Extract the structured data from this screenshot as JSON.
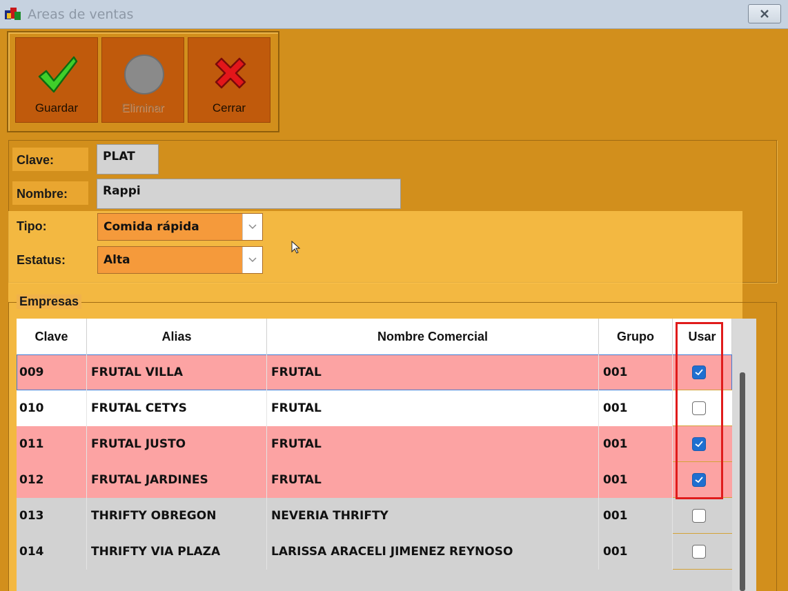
{
  "window": {
    "title": "Areas de ventas",
    "icon": "app-icon",
    "close_icon": "close-icon"
  },
  "toolbar": {
    "buttons": [
      {
        "label": "Guardar",
        "icon": "check-icon",
        "enabled": true
      },
      {
        "label": "Eliminar",
        "icon": "gray-circle-icon",
        "enabled": false
      },
      {
        "label": "Cerrar",
        "icon": "red-x-icon",
        "enabled": true
      }
    ]
  },
  "form": {
    "clave_label": "Clave:",
    "clave_value": "PLAT",
    "nombre_label": "Nombre:",
    "nombre_value": "Rappi",
    "tipo_label": "Tipo:",
    "tipo_value": "Comida rápida",
    "estatus_label": "Estatus:",
    "estatus_value": "Alta"
  },
  "empresas": {
    "legend": "Empresas",
    "columns": [
      "Clave",
      "Alias",
      "Nombre Comercial",
      "Grupo",
      "Usar"
    ],
    "rows": [
      {
        "clave": "009",
        "alias": "FRUTAL VILLA",
        "nombre": "FRUTAL",
        "grupo": "001",
        "usar": true
      },
      {
        "clave": "010",
        "alias": "FRUTAL CETYS",
        "nombre": "FRUTAL",
        "grupo": "001",
        "usar": false
      },
      {
        "clave": "011",
        "alias": "FRUTAL JUSTO",
        "nombre": "FRUTAL",
        "grupo": "001",
        "usar": true
      },
      {
        "clave": "012",
        "alias": "FRUTAL JARDINES",
        "nombre": "FRUTAL",
        "grupo": "001",
        "usar": true
      },
      {
        "clave": "013",
        "alias": "THRIFTY OBREGON",
        "nombre": "NEVERIA THRIFTY",
        "grupo": "001",
        "usar": false
      },
      {
        "clave": "014",
        "alias": "THRIFTY VIA PLAZA",
        "nombre": "LARISSA ARACELI JIMENEZ REYNOSO",
        "grupo": "001",
        "usar": false
      }
    ]
  },
  "colors": {
    "form_bg": "#d28f1c",
    "toolbar_button": "#c05a0c",
    "row_selected": "#fca3a3",
    "highlight_box": "#e01b1b"
  }
}
